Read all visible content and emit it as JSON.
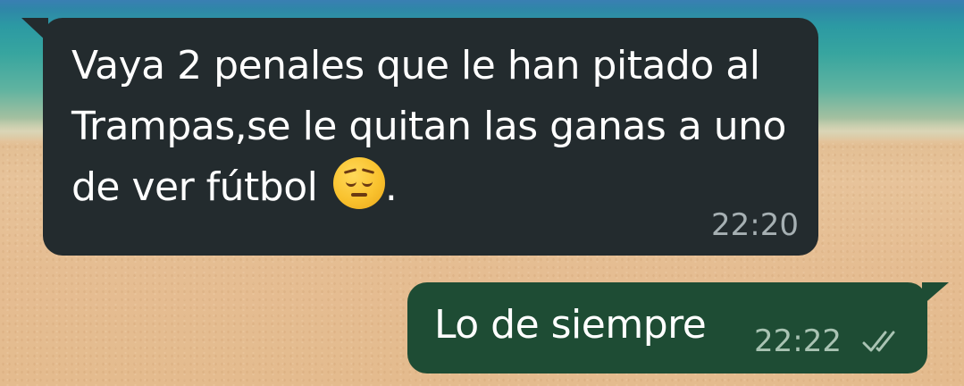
{
  "chat": {
    "messages": [
      {
        "direction": "incoming",
        "text": "Vaya 2 penales que le han pitado al Trampas,se le quitan las ganas a uno de ver fútbol",
        "emoji": "pensive-face",
        "trailing": ".",
        "time": "22:20"
      },
      {
        "direction": "outgoing",
        "text": "Lo de siempre",
        "time": "22:22",
        "status": "read",
        "status_icon": "double-check-icon"
      }
    ]
  },
  "colors": {
    "incoming_bubble": "#232b2e",
    "outgoing_bubble": "#1e4c34",
    "message_text": "#ffffff",
    "incoming_time": "#a6b0b3",
    "outgoing_time": "#a9c3b3"
  }
}
